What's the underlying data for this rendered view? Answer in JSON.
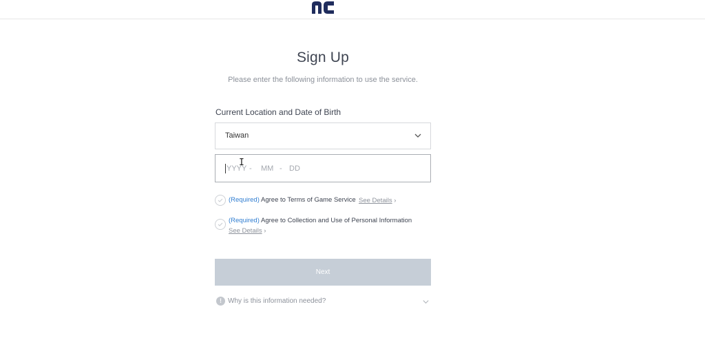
{
  "header": {
    "logo_name": "nc-logo",
    "brand_color": "#1f2c5c"
  },
  "page": {
    "title": "Sign Up",
    "subtitle": "Please enter the following information to use the service."
  },
  "form": {
    "section_label": "Current Location and Date of Birth",
    "location": {
      "selected": "Taiwan"
    },
    "dob": {
      "year_placeholder": "YYYY",
      "month_placeholder": "MM",
      "day_placeholder": "DD",
      "separator": "-"
    }
  },
  "agreements": [
    {
      "required_label": "(Required)",
      "text": "Agree to Terms of Game Service",
      "details": "See Details",
      "arrow": "›"
    },
    {
      "required_label": "(Required)",
      "text": "Agree to Collection and Use of Personal Information",
      "details": "See Details",
      "arrow": "›"
    }
  ],
  "actions": {
    "next_label": "Next"
  },
  "help": {
    "info_glyph": "!",
    "why_label": "Why is this information needed?"
  },
  "colors": {
    "required_blue": "#2f7dd1",
    "disabled_button": "#c6ced7"
  }
}
